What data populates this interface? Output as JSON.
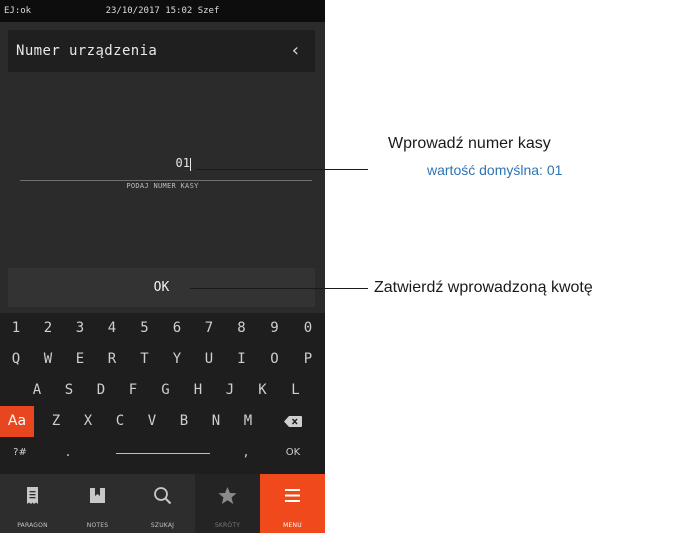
{
  "status": {
    "left": "EJ:ok",
    "center": "23/10/2017 15:02 Szef"
  },
  "header": {
    "title": "Numer urządzenia",
    "back_icon": "chevron-left"
  },
  "input": {
    "value": "01",
    "hint": "PODAJ NUMER KASY"
  },
  "ok_button": {
    "label": "OK"
  },
  "keyboard": {
    "row1": [
      "1",
      "2",
      "3",
      "4",
      "5",
      "6",
      "7",
      "8",
      "9",
      "0"
    ],
    "row2": [
      "Q",
      "W",
      "E",
      "R",
      "T",
      "Y",
      "U",
      "I",
      "O",
      "P"
    ],
    "row3": [
      "A",
      "S",
      "D",
      "F",
      "G",
      "H",
      "J",
      "K",
      "L"
    ],
    "row4": {
      "shift": "Aa",
      "keys": [
        "Z",
        "X",
        "C",
        "V",
        "B",
        "N",
        "M"
      ],
      "backspace_icon": "backspace"
    },
    "row5": {
      "symbols": "?#",
      "dot": ".",
      "comma": ",",
      "ok": "OK"
    }
  },
  "nav": [
    {
      "label": "PARAGON",
      "icon": "receipt",
      "state": "normal"
    },
    {
      "label": "NOTES",
      "icon": "notebook",
      "state": "normal"
    },
    {
      "label": "SZUKAJ",
      "icon": "search",
      "state": "normal"
    },
    {
      "label": "SKRÓTY",
      "icon": "star",
      "state": "dim"
    },
    {
      "label": "MENU",
      "icon": "hamburger",
      "state": "active"
    }
  ],
  "annotations": {
    "input_title": "Wprowadź numer kasy",
    "input_sub": "wartość domyślna: 01",
    "ok_title": "Zatwierdź wprowadzoną kwotę"
  },
  "colors": {
    "accent": "#f04a1c",
    "annotation_blue": "#2e74b5",
    "device_bg": "#2b2b2b"
  }
}
